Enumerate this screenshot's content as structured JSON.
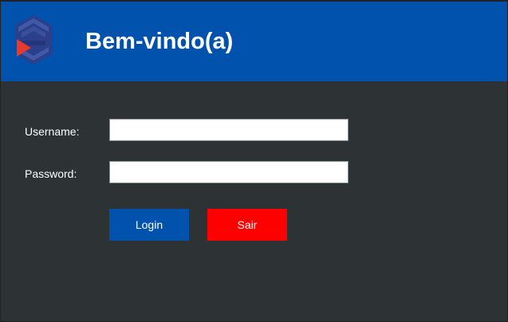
{
  "header": {
    "title": "Bem-vindo(a)",
    "logo_icon": "shield-play-logo-icon"
  },
  "form": {
    "username_label": "Username:",
    "username_value": "",
    "password_label": "Password:",
    "password_value": ""
  },
  "buttons": {
    "login_label": "Login",
    "exit_label": "Sair"
  },
  "colors": {
    "header_bg": "#0052ac",
    "body_bg": "#2d3335",
    "login_button": "#0052ac",
    "exit_button": "#ff0000",
    "logo_accent": "#e63a2e"
  }
}
